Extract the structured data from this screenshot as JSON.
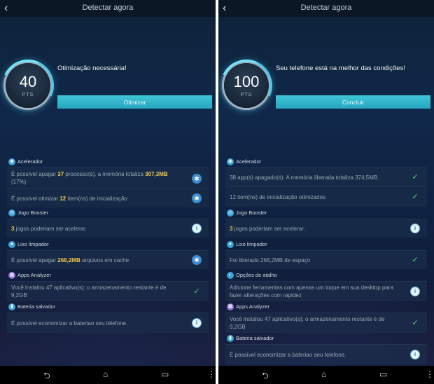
{
  "left": {
    "title": "Detectar agora",
    "score": "40",
    "pts": "PTS",
    "headline": "Otimização necessária!",
    "action": "Otimizar",
    "sections": {
      "acelerador": "Acelerador",
      "jogo": "Jogo Booster",
      "lixo": "Lixo limpador",
      "apps": "Apps Analyzer",
      "bateria": "Bateria salvador"
    },
    "rows": {
      "r1": {
        "p1": "É possível apagar ",
        "h1": "37",
        "p2": " processo(s), a memória totaliza ",
        "h2": "307,3MB",
        "p3": " (17%)"
      },
      "r2": {
        "p1": "É possível otimizar ",
        "h1": "12",
        "p2": " item(ns) de inicialização"
      },
      "r3": {
        "h1": "3",
        "p1": " jogos poderiam ser acelerar."
      },
      "r4": {
        "p1": "É possível apagar ",
        "h1": "268,2MB",
        "p2": " arquivos em cache"
      },
      "r5": {
        "text": "Você instalou 47 aplicativo(s); o armazenamento restante é de 9,2GB"
      },
      "r6": {
        "text": "É possível economizar a bateriao seu telefone."
      }
    }
  },
  "right": {
    "title": "Detectar agora",
    "score": "100",
    "pts": "PTS",
    "headline": "Seu telefone está na melhor das condições!",
    "action": "Concluir",
    "sections": {
      "acelerador": "Acelerador",
      "jogo": "Jogo Booster",
      "lixo": "Lixo limpador",
      "atalho": "Opções de atalho",
      "apps": "Apps Analyzer",
      "bateria": "Bateria salvador"
    },
    "rows": {
      "r1": {
        "text": "38 app(s) apagado(s). A memória liberada totaliza 374,5MB."
      },
      "r2": {
        "text": "12 item(ns) de inicialização otimizados"
      },
      "r3": {
        "h1": "3",
        "p1": " jogos poderiam ser acelerar."
      },
      "r4": {
        "text": "Foi liberado 268,2MB de espaço"
      },
      "r5": {
        "text": "Adicione ferramentas com apenas um toque em sua desktop para fazer alterações com rapidez"
      },
      "r6": {
        "text": "Você instalou 47 aplicativo(s); o armazenamento restante é de 9,2GB"
      },
      "r7": {
        "text": "É possível economizar a bateriao seu telefone."
      }
    }
  },
  "icons": {
    "back": "‹",
    "broom": "✱",
    "info": "i",
    "check": "✓",
    "nav_back": "⮌",
    "nav_home": "⌂",
    "nav_recent": "▭",
    "menu": "⋮"
  }
}
